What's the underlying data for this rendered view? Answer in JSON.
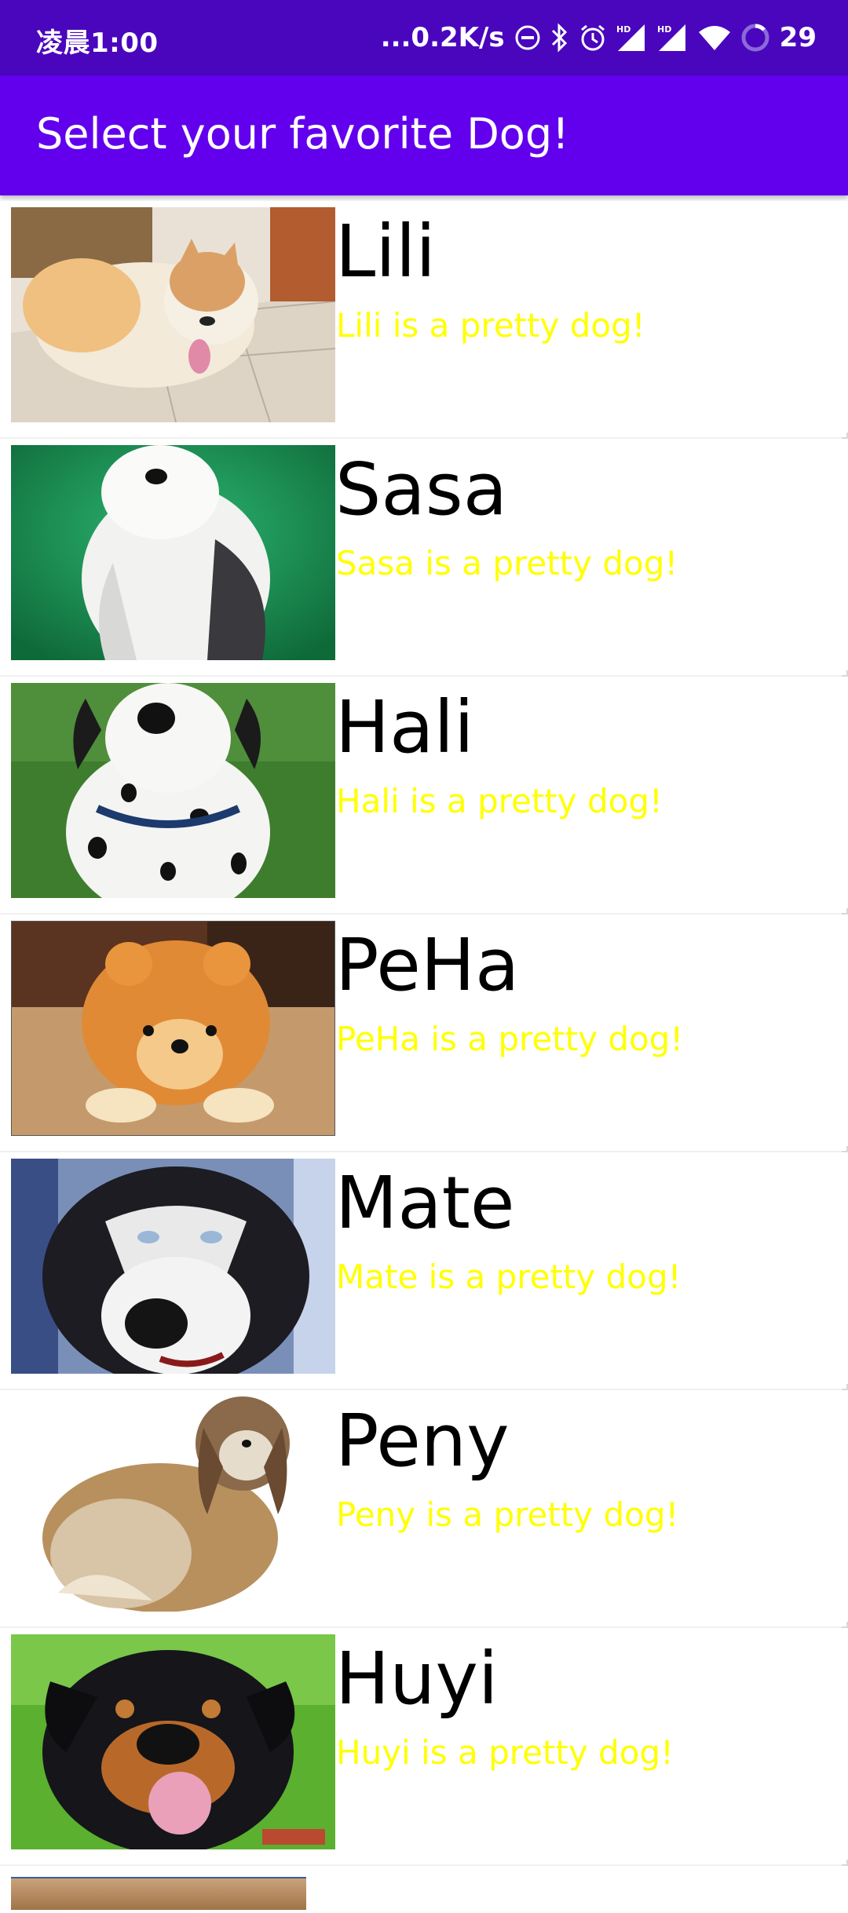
{
  "status_bar": {
    "time": "凌晨1:00",
    "network_speed": "...0.2K/s",
    "battery": "29",
    "icons": [
      "do-not-disturb-icon",
      "bluetooth-icon",
      "alarm-icon",
      "signal-hd-icon",
      "signal-hd-icon",
      "wifi-icon",
      "battery-ring-icon"
    ]
  },
  "app_bar": {
    "title": "Select your favorite Dog!"
  },
  "dogs": [
    {
      "name": "Lili",
      "description": "Lili is a pretty dog!"
    },
    {
      "name": "Sasa",
      "description": "Sasa is a pretty dog!"
    },
    {
      "name": "Hali",
      "description": "Hali is a pretty dog!"
    },
    {
      "name": "PeHa",
      "description": "PeHa is a pretty dog!"
    },
    {
      "name": "Mate",
      "description": "Mate is a pretty dog!"
    },
    {
      "name": "Peny",
      "description": "Peny is a pretty dog!"
    },
    {
      "name": "Huyi",
      "description": "Huyi is a pretty dog!"
    }
  ],
  "colors": {
    "status_bar": "#4a06bd",
    "app_bar": "#6200ee",
    "name_text": "#000000",
    "description_text": "#ffff00"
  }
}
